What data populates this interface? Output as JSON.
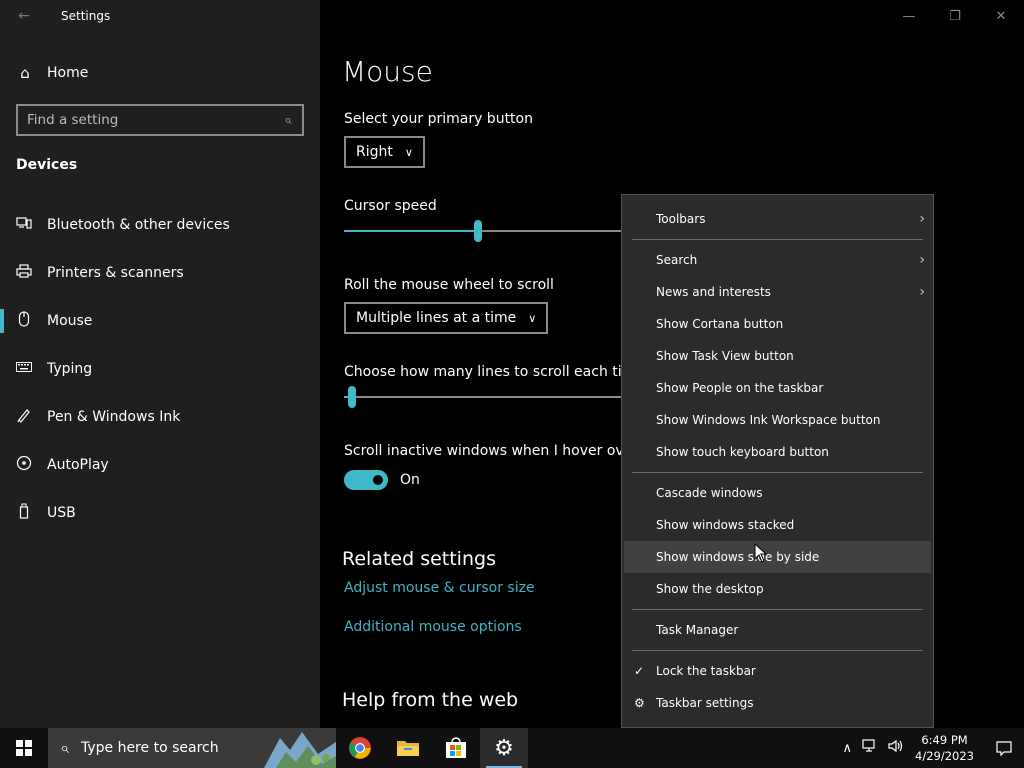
{
  "app": {
    "title": "Settings"
  },
  "sidebar": {
    "home_label": "Home",
    "search_placeholder": "Find a setting",
    "section": "Devices",
    "items": [
      {
        "label": "Bluetooth & other devices",
        "icon": "bluetooth-devices-icon"
      },
      {
        "label": "Printers & scanners",
        "icon": "printer-icon"
      },
      {
        "label": "Mouse",
        "icon": "mouse-icon",
        "active": true
      },
      {
        "label": "Typing",
        "icon": "keyboard-icon"
      },
      {
        "label": "Pen & Windows Ink",
        "icon": "pen-icon"
      },
      {
        "label": "AutoPlay",
        "icon": "autoplay-icon"
      },
      {
        "label": "USB",
        "icon": "usb-icon"
      }
    ]
  },
  "main": {
    "title": "Mouse",
    "primary_button": {
      "label": "Select your primary button",
      "value": "Right"
    },
    "cursor_speed": {
      "label": "Cursor speed",
      "level": 0.48
    },
    "scroll_mode": {
      "label": "Roll the mouse wheel to scroll",
      "value": "Multiple lines at a time"
    },
    "scroll_lines": {
      "label": "Choose how many lines to scroll each time",
      "level": 0.03
    },
    "inactive_scroll": {
      "label": "Scroll inactive windows when I hover over them",
      "state": "On"
    },
    "related": {
      "heading": "Related settings",
      "links": [
        "Adjust mouse & cursor size",
        "Additional mouse options"
      ]
    },
    "help_heading": "Help from the web"
  },
  "context_menu": {
    "items": {
      "toolbars": "Toolbars",
      "search": "Search",
      "news": "News and interests",
      "cortana": "Show Cortana button",
      "taskview": "Show Task View button",
      "people": "Show People on the taskbar",
      "ink": "Show Windows Ink Workspace button",
      "touchkb": "Show touch keyboard button",
      "cascade": "Cascade windows",
      "stacked": "Show windows stacked",
      "sidebyside": "Show windows side by side",
      "desktop": "Show the desktop",
      "taskmgr": "Task Manager",
      "lock": "Lock the taskbar",
      "tbsettings": "Taskbar settings"
    }
  },
  "taskbar": {
    "search_placeholder": "Type here to search",
    "pinned": [
      "chrome-icon",
      "file-explorer-icon",
      "store-icon",
      "settings-icon"
    ],
    "time": "6:49 PM",
    "date": "4/29/2023"
  },
  "colors": {
    "accent": "#41b9c9",
    "link": "#3fb4c4"
  }
}
